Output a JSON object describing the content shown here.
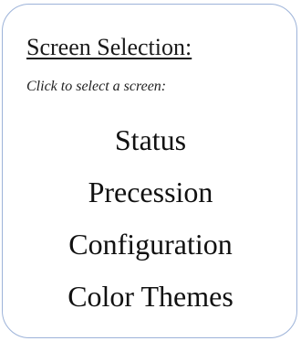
{
  "panel": {
    "title": "Screen Selection:",
    "instruction": "Click to select a screen:",
    "items": [
      {
        "label": "Status"
      },
      {
        "label": "Precession"
      },
      {
        "label": "Configuration"
      },
      {
        "label": "Color Themes"
      }
    ],
    "colors": {
      "border": "#9db3d9",
      "text": "#111111",
      "background": "#ffffff"
    }
  }
}
